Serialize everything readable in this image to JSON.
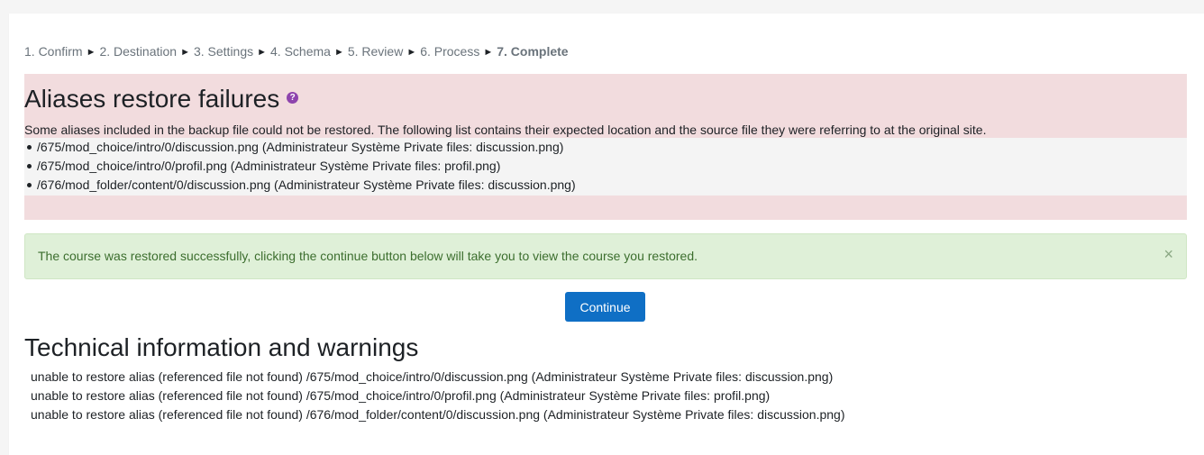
{
  "breadcrumb": {
    "steps": [
      "1. Confirm",
      "2. Destination",
      "3. Settings",
      "4. Schema",
      "5. Review",
      "6. Process"
    ],
    "current": "7. Complete",
    "separator": "►"
  },
  "alias_failures": {
    "title": "Aliases restore failures",
    "help_glyph": "?",
    "description": "Some aliases included in the backup file could not be restored. The following list contains their expected location and the source file they were referring to at the original site.",
    "items": [
      "/675/mod_choice/intro/0/discussion.png (Administrateur Système Private files: discussion.png)",
      "/675/mod_choice/intro/0/profil.png (Administrateur Système Private files: profil.png)",
      "/676/mod_folder/content/0/discussion.png (Administrateur Système Private files: discussion.png)"
    ]
  },
  "success": {
    "message": "The course was restored successfully, clicking the continue button below will take you to view the course you restored.",
    "close_glyph": "×"
  },
  "continue_label": "Continue",
  "technical": {
    "title": "Technical information and warnings",
    "items": [
      "unable to restore alias (referenced file not found) /675/mod_choice/intro/0/discussion.png (Administrateur Système Private files: discussion.png)",
      "unable to restore alias (referenced file not found) /675/mod_choice/intro/0/profil.png (Administrateur Système Private files: profil.png)",
      "unable to restore alias (referenced file not found) /676/mod_folder/content/0/discussion.png (Administrateur Système Private files: discussion.png)"
    ]
  },
  "colors": {
    "error_bg": "#f2dcde",
    "list_bg": "#f4f4f4",
    "success_bg": "#dff0d8",
    "success_text": "#3c6e2e",
    "primary": "#0f6fc5",
    "help_icon": "#8e44ad"
  }
}
